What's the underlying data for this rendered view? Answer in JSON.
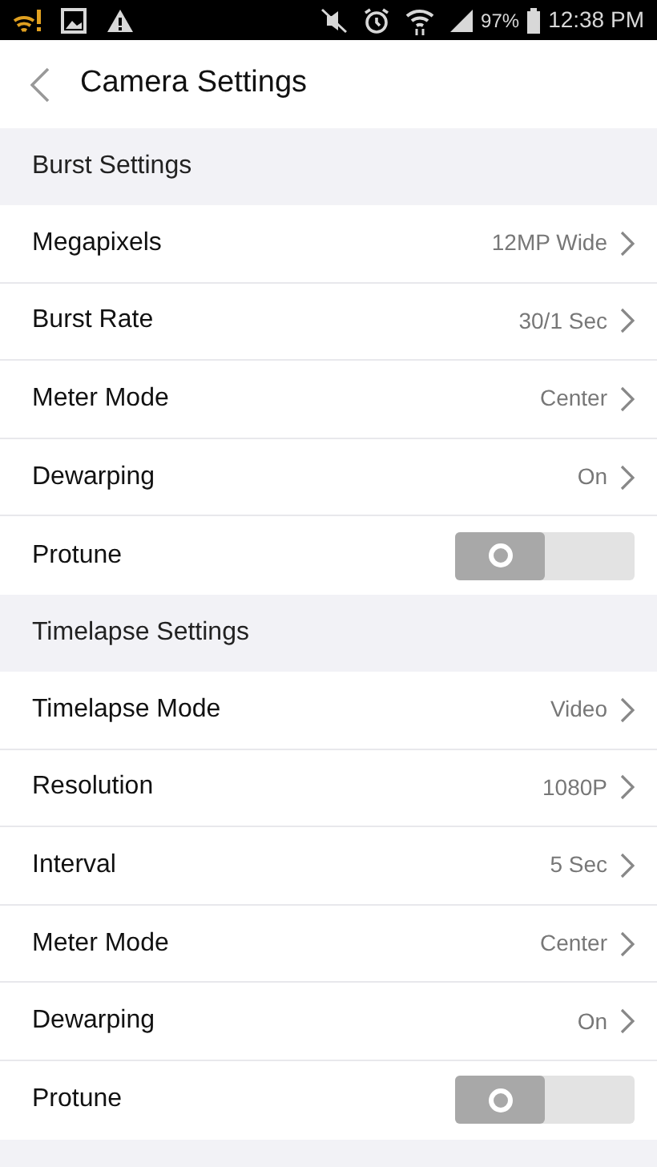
{
  "status_bar": {
    "battery": "97%",
    "time": "12:38 PM"
  },
  "header": {
    "title": "Camera Settings"
  },
  "sections": [
    {
      "title": "Burst Settings",
      "items": [
        {
          "kind": "value",
          "label": "Megapixels",
          "value": "12MP Wide"
        },
        {
          "kind": "value",
          "label": "Burst Rate",
          "value": "30/1 Sec"
        },
        {
          "kind": "value",
          "label": "Meter Mode",
          "value": "Center"
        },
        {
          "kind": "value",
          "label": "Dewarping",
          "value": "On"
        },
        {
          "kind": "toggle",
          "label": "Protune",
          "on": false
        }
      ]
    },
    {
      "title": "Timelapse Settings",
      "items": [
        {
          "kind": "value",
          "label": "Timelapse Mode",
          "value": "Video"
        },
        {
          "kind": "value",
          "label": "Resolution",
          "value": "1080P"
        },
        {
          "kind": "value",
          "label": "Interval",
          "value": "5 Sec"
        },
        {
          "kind": "value",
          "label": "Meter Mode",
          "value": "Center"
        },
        {
          "kind": "value",
          "label": "Dewarping",
          "value": "On"
        },
        {
          "kind": "toggle",
          "label": "Protune",
          "on": false
        }
      ]
    }
  ]
}
